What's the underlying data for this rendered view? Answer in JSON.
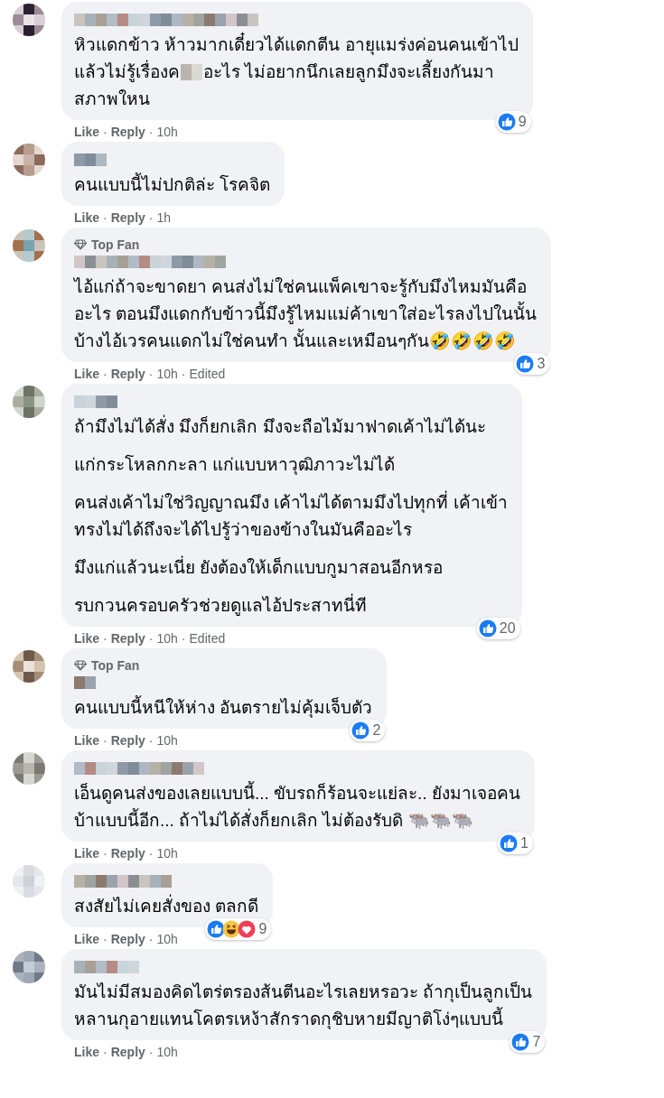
{
  "meta_separator": "·",
  "comments": [
    {
      "lines": [
        [
          {
            "kind": "text",
            "text": "หิวแดกข้าว ห้าวมากเดี๋ยวได้แดกตีน อายุแมร่งค่อนคนเข้าไป"
          }
        ],
        [
          {
            "kind": "text",
            "text": "แล้วไม่รู้เรื่องค"
          },
          {
            "kind": "censored"
          },
          {
            "kind": "text",
            "text": "อะไร ไม่อยากนึกเลยลูกมึงจะเลี้ยงกันมา"
          }
        ],
        [
          {
            "kind": "text",
            "text": "สภาพใหน"
          }
        ]
      ],
      "meta": [
        "Like",
        "Reply",
        "10h"
      ],
      "reactions": {
        "icons": [
          {
            "kind": "like"
          }
        ],
        "count": "9"
      }
    },
    {
      "paragraphs": [
        "คนแบบนี้ไม่ปกติล่ะ โรคจิต"
      ],
      "meta": [
        "Like",
        "Reply",
        "1h"
      ]
    },
    {
      "badge": "Top Fan",
      "paragraphs": [
        "ไอ้แก่ถ้าจะขาดยา คนส่งไม่ใช่คนแพ็คเขาจะรู้กับมึงไหมมันคือ\nอะไร ตอนมึงแดกกับข้าวนี้มึงรู้ไหมแม่ค้าเขาใส่อะไรลงไปในนั้น\nบ้างไอ้เวรคนแดกไม่ใช่คนทำ นั้นและเหมือนๆกัน🤣🤣🤣🤣"
      ],
      "meta": [
        "Like",
        "Reply",
        "10h",
        "Edited"
      ],
      "reactions": {
        "icons": [
          {
            "kind": "like"
          }
        ],
        "count": "3"
      }
    },
    {
      "paragraphs": [
        "ถ้ามึงไม่ได้สั่ง มึงก็ยกเลิก มึงจะถือไม้มาฟาดเค้าไม่ได้นะ",
        "แก่กระโหลกกะลา แก่แบบหาวุฒิภาวะไม่ได้",
        "คนส่งเค้าไม่ใช่วิญญาณมึง เค้าไม่ได้ตามมึงไปทุกที่ เค้าเข้า\nทรงไม่ได้ถึงจะได้ไปรู้ว่าของข้างในมันคืออะไร",
        "มึงแก่แล้วนะเนี่ย ยังต้องให้เด็กแบบกูมาสอนอีกหรอ",
        "รบกวนครอบครัวช่วยดูแลไอ้ประสาทนี่ที"
      ],
      "meta": [
        "Like",
        "Reply",
        "10h",
        "Edited"
      ],
      "reactions": {
        "icons": [
          {
            "kind": "like"
          }
        ],
        "count": "20"
      }
    },
    {
      "badge": "Top Fan",
      "paragraphs": [
        "คนแบบนี้หนีให้ห่าง อันตรายไม่คุ้มเจ็บตัว"
      ],
      "meta": [
        "Like",
        "Reply",
        "10h"
      ],
      "reactions": {
        "icons": [
          {
            "kind": "like"
          }
        ],
        "count": "2"
      }
    },
    {
      "paragraphs": [
        "เอ็นดูคนส่งของเลยแบบนี้... ขับรถก็ร้อนจะแย่ละ.. ยังมาเจอคน\nบ้าแบบนี้อีก... ถ้าไม่ได้สั่งก็ยกเลิก ไม่ต้องรับดิ 🐃🐃🐃"
      ],
      "meta": [
        "Like",
        "Reply",
        "10h"
      ],
      "reactions": {
        "icons": [
          {
            "kind": "like"
          }
        ],
        "count": "1"
      }
    },
    {
      "paragraphs": [
        "สงสัยไม่เคยสั่งของ ตลกดี"
      ],
      "meta": [
        "Like",
        "Reply",
        "10h"
      ],
      "reactions": {
        "icons": [
          {
            "kind": "like"
          },
          {
            "kind": "haha"
          },
          {
            "kind": "love"
          }
        ],
        "count": "9"
      }
    },
    {
      "paragraphs": [
        "มันไม่มีสมองคิดไตร่ตรองส้นตีนอะไรเลยหรอวะ ถ้ากุเป็นลูกเป็น\nหลานกุอายแทนโคตรเหง้าสักราดกุชิบหายมีญาติโง่ๆแบบนี้"
      ],
      "meta": [
        "Like",
        "Reply",
        "10h"
      ],
      "reactions": {
        "icons": [
          {
            "kind": "like"
          }
        ],
        "count": "7"
      }
    }
  ]
}
